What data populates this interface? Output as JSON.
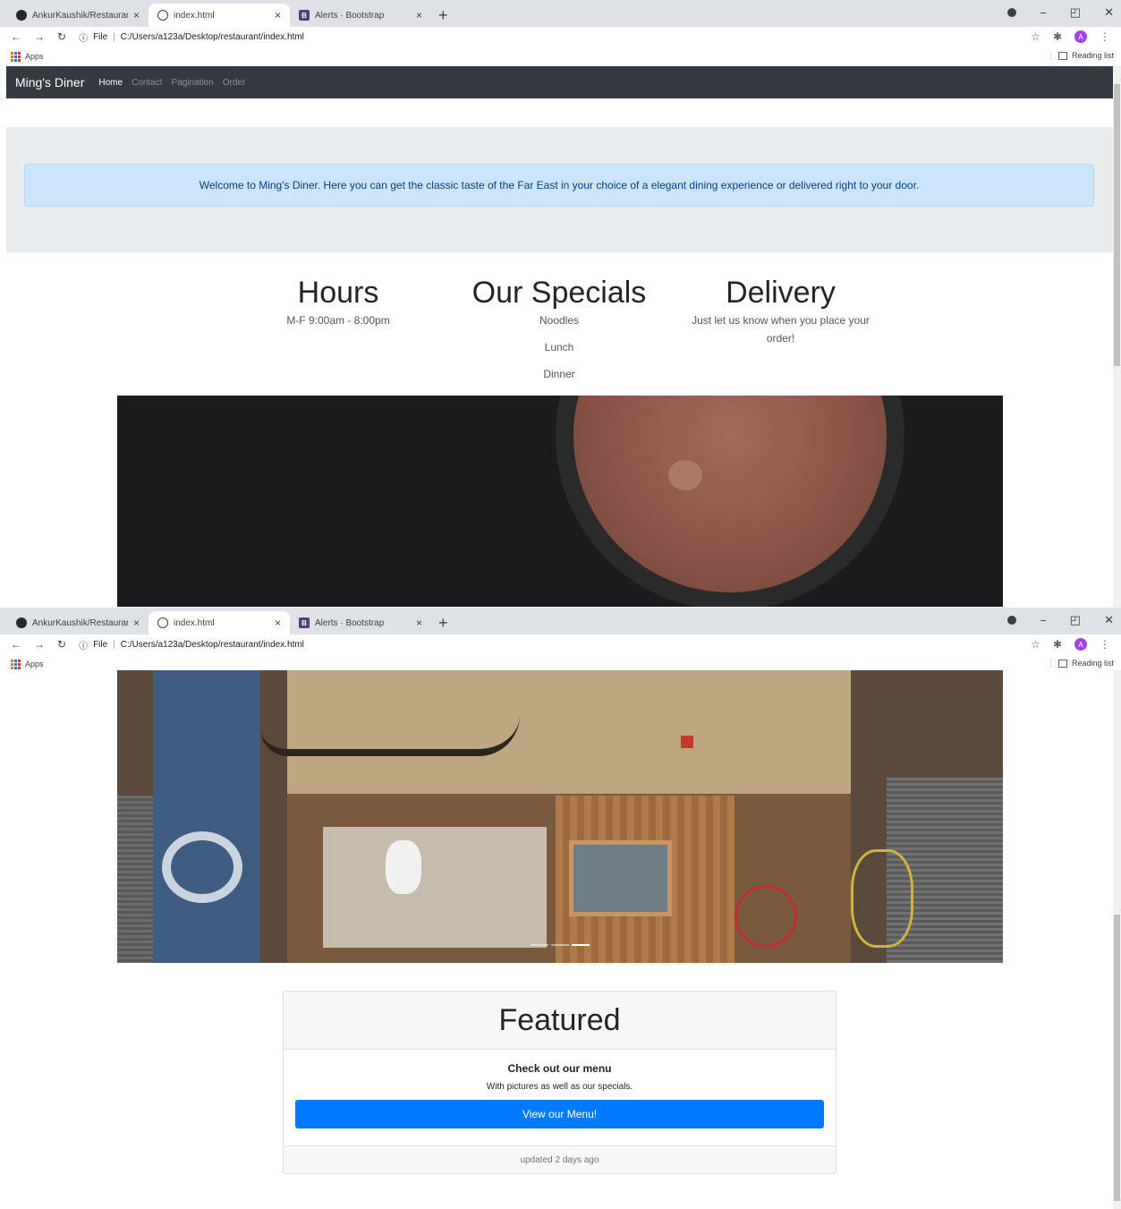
{
  "browser": {
    "tabs": [
      {
        "title": "AnkurKaushik/Restaurant-Fronte",
        "favicon": "github-icon"
      },
      {
        "title": "index.html",
        "favicon": "globe-icon"
      },
      {
        "title": "Alerts · Bootstrap",
        "favicon": "bootstrap-icon"
      }
    ],
    "tab_close": "×",
    "new_tab": "+",
    "url_scheme": "File",
    "url": "C:/Users/a123a/Desktop/restaurant/index.html",
    "avatar_letter": "A",
    "bookmarks_apps": "Apps",
    "reading_list": "Reading list"
  },
  "navbar": {
    "brand": "Ming's Diner",
    "links": [
      "Home",
      "Contact",
      "Pagination",
      "Order"
    ],
    "active_link": "Home"
  },
  "alert": {
    "text": "Welcome to Ming's Diner. Here you can get the classic taste of the Far East in your choice of a elegant dining experience or delivered right to your door."
  },
  "info_columns": {
    "hours": {
      "title": "Hours",
      "text": "M-F 9:00am - 8:00pm"
    },
    "specials": {
      "title": "Our Specials",
      "items": [
        "Noodles",
        "Lunch",
        "Dinner"
      ]
    },
    "delivery": {
      "title": "Delivery",
      "text": "Just let us know when you place your order!"
    }
  },
  "carousel": {
    "slides": 3,
    "active_slide": 3
  },
  "card": {
    "header": "Featured",
    "title": "Check out our menu",
    "text": "With pictures as well as our specials.",
    "button": "View our Menu!",
    "footer": "updated 2 days ago"
  },
  "colors": {
    "navbar_bg": "#343a40",
    "alert_bg": "#cce5ff",
    "primary": "#007bff"
  }
}
